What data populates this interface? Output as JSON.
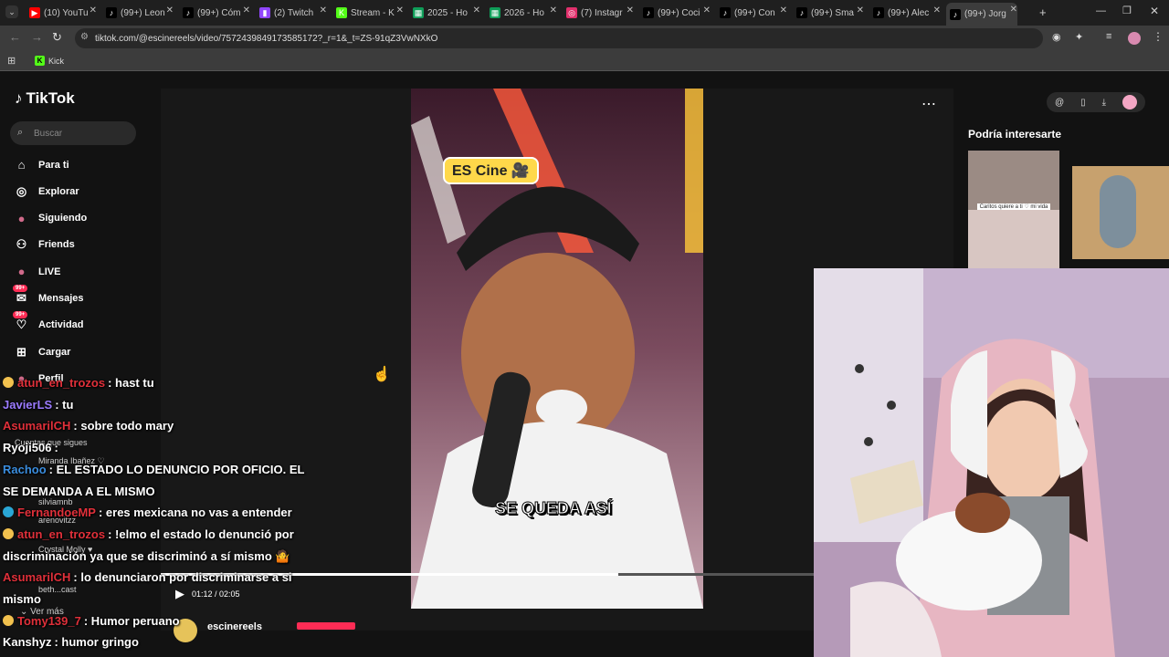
{
  "browser": {
    "tabs": [
      {
        "label": "(10) YouTu",
        "color": "#ff0000",
        "glyph": "▶"
      },
      {
        "label": "(99+) Leon",
        "color": "#000000",
        "glyph": "♪"
      },
      {
        "label": "(99+) Cóm",
        "color": "#000000",
        "glyph": "♪"
      },
      {
        "label": "(2) Twitch",
        "color": "#9146ff",
        "glyph": "▮"
      },
      {
        "label": "Stream - K",
        "color": "#53fc18",
        "glyph": "K"
      },
      {
        "label": "2025 - Ho",
        "color": "#0f9d58",
        "glyph": "▦"
      },
      {
        "label": "2026 - Ho",
        "color": "#0f9d58",
        "glyph": "▦"
      },
      {
        "label": "(7) Instagr",
        "color": "#e1306c",
        "glyph": "◎"
      },
      {
        "label": "(99+) Coci",
        "color": "#000000",
        "glyph": "♪"
      },
      {
        "label": "(99+) Con",
        "color": "#000000",
        "glyph": "♪"
      },
      {
        "label": "(99+) Sma",
        "color": "#000000",
        "glyph": "♪"
      },
      {
        "label": "(99+) Alec",
        "color": "#000000",
        "glyph": "♪"
      },
      {
        "label": "(99+) Jorg",
        "color": "#000000",
        "glyph": "♪",
        "active": true
      }
    ],
    "url": "tiktok.com/@escinereels/video/7572439849173585172?_r=1&_t=ZS-91qZ3VwNXkO",
    "bookmark": "Kick"
  },
  "tiktok": {
    "logo": "TikTok",
    "search_placeholder": "Buscar",
    "nav": [
      {
        "label": "Para ti",
        "icon": "home-icon"
      },
      {
        "label": "Explorar",
        "icon": "compass-icon"
      },
      {
        "label": "Siguiendo",
        "icon": "following-avatar-icon"
      },
      {
        "label": "Friends",
        "icon": "friends-icon"
      },
      {
        "label": "LIVE",
        "icon": "live-icon"
      },
      {
        "label": "Mensajes",
        "icon": "messages-icon",
        "badge": "99+"
      },
      {
        "label": "Actividad",
        "icon": "activity-icon",
        "badge": "99+"
      },
      {
        "label": "Cargar",
        "icon": "upload-icon"
      },
      {
        "label": "Perfil",
        "icon": "profile-icon"
      }
    ],
    "following_heading": "Cuentas que sigues",
    "following": [
      "Miranda Ibañez ♡",
      "silviamnb",
      "arenovitzz",
      "Crystal Molly ♥",
      "beth...cast"
    ],
    "see_more": "Ver más",
    "video_caption_top": "ES Cine",
    "video_caption_bottom": "SE QUEDA ASÍ",
    "time": "01:12 / 02:05",
    "progress": 0.7,
    "author": "escinereels",
    "suggest_title": "Podría interesarte",
    "suggest_thumb_text": "Caritos quiere a ti ♡ mi vida"
  },
  "chat": [
    {
      "user": "atun_en_trozos",
      "color": "#e0303a",
      "text": ": hast tu",
      "pre": "#f2c14e"
    },
    {
      "user": "JavierLS",
      "color": "#9b7bff",
      "text": ": tu"
    },
    {
      "user": "AsumarilCH",
      "color": "#e0303a",
      "text": ": sobre todo mary"
    },
    {
      "user": "Ryoji506",
      "color": "#ffffff",
      "text": ":"
    },
    {
      "user": "Rachoo",
      "color": "#3a8dde",
      "text": ": EL ESTADO LO DENUNCIO POR OFICIO. EL"
    },
    {
      "user": "",
      "color": "#ffffff",
      "text": "SE DEMANDA A EL MISMO"
    },
    {
      "user": "FernandoeMP",
      "color": "#e0303a",
      "text": ": eres mexicana no vas a entender",
      "pre": "#2aa7d6"
    },
    {
      "user": "atun_en_trozos",
      "color": "#e0303a",
      "text": ": !elmo el estado lo denunció por",
      "pre": "#f2c14e"
    },
    {
      "user": "",
      "color": "#ffffff",
      "text": "discriminación ya que se discriminó a sí mismo 🤷"
    },
    {
      "user": "AsumarilCH",
      "color": "#e0303a",
      "text": ": lo denunciaron por discriminarse a si"
    },
    {
      "user": "",
      "color": "#ffffff",
      "text": "mismo"
    },
    {
      "user": "Tomy139_7",
      "color": "#e0303a",
      "text": ": Humor peruano",
      "pre": "#f2c14e"
    },
    {
      "user": "Kanshyz",
      "color": "#ffffff",
      "text": ": humor gringo"
    }
  ]
}
